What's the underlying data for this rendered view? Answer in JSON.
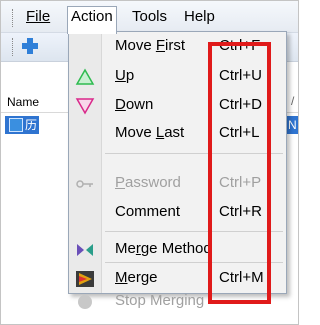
{
  "menubar": {
    "items": [
      {
        "label": "File"
      },
      {
        "label": "Action"
      },
      {
        "label": "Tools"
      },
      {
        "label": "Help"
      }
    ]
  },
  "list": {
    "header_name": "Name",
    "header_right": "/",
    "row_text": "历",
    "row_right_text": "N"
  },
  "dropdown": {
    "items": [
      {
        "label": "Move First",
        "shortcut": "Ctrl+F",
        "icon": "none",
        "disabled": false
      },
      {
        "label": "Up",
        "shortcut": "Ctrl+U",
        "icon": "up-triangle-icon",
        "disabled": false
      },
      {
        "label": "Down",
        "shortcut": "Ctrl+D",
        "icon": "down-triangle-icon",
        "disabled": false
      },
      {
        "label": "Move Last",
        "shortcut": "Ctrl+L",
        "icon": "none",
        "disabled": false
      },
      {
        "label": "Password",
        "shortcut": "Ctrl+P",
        "icon": "key-icon",
        "disabled": true
      },
      {
        "label": "Comment",
        "shortcut": "Ctrl+R",
        "icon": "none",
        "disabled": false
      },
      {
        "label": "Merge Method",
        "shortcut": "",
        "icon": "merge-method-icon",
        "disabled": false
      },
      {
        "label": "Merge",
        "shortcut": "Ctrl+M",
        "icon": "merge-icon",
        "disabled": false
      },
      {
        "label": "Stop Merging",
        "shortcut": "",
        "icon": "stop-icon",
        "disabled": true
      }
    ]
  },
  "colors": {
    "highlight": "#e01a1a",
    "selection": "#2f74d0",
    "up_icon": "#2dbb4f",
    "down_icon": "#d9288a",
    "merge_icon": "#e0a010"
  }
}
